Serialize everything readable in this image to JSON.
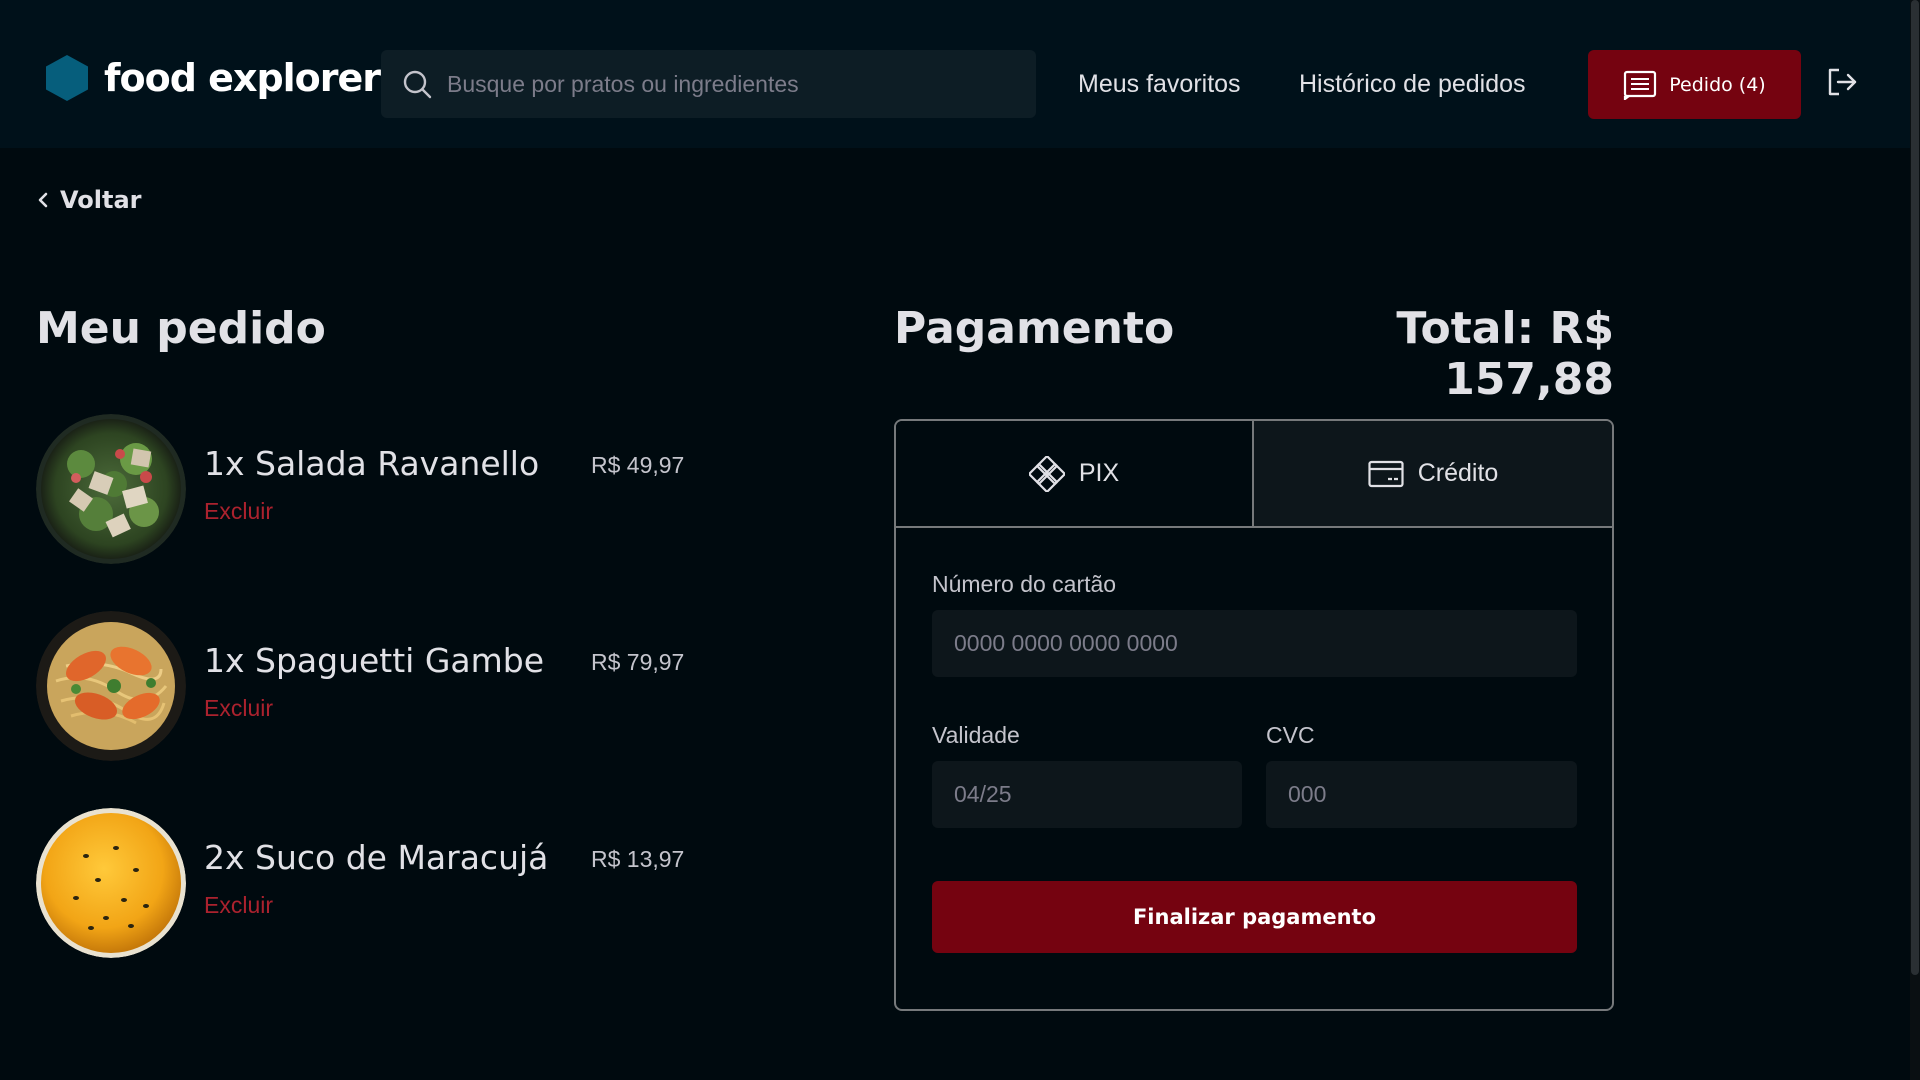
{
  "header": {
    "brand": "food explorer",
    "search_placeholder": "Busque por pratos ou ingredientes",
    "nav_favorites": "Meus favoritos",
    "nav_history": "Histórico de pedidos",
    "order_button_label": "Pedido (4)",
    "icons": {
      "logo": "hexagon-logo-icon",
      "search": "search-icon",
      "order": "receipt-icon",
      "signout": "sign-out-icon"
    }
  },
  "back_label": "Voltar",
  "order": {
    "title": "Meu pedido",
    "delete_label": "Excluir",
    "items": [
      {
        "name": "1x Salada Ravanello",
        "price": "R$ 49,97",
        "image": "salad-dish"
      },
      {
        "name": "1x Spaguetti Gambe",
        "price": "R$ 79,97",
        "image": "shrimp-spaghetti-dish"
      },
      {
        "name": "2x Suco de Maracujá",
        "price": "R$ 13,97",
        "image": "passion-fruit-juice"
      }
    ]
  },
  "payment": {
    "title": "Pagamento",
    "total": "Total: R$ 157,88",
    "tabs": [
      {
        "label": "PIX",
        "icon": "pix-icon",
        "selected": false
      },
      {
        "label": "Crédito",
        "icon": "credit-card-icon",
        "selected": true
      }
    ],
    "card_number_label": "Número do cartão",
    "card_number_placeholder": "0000 0000 0000 0000",
    "expiry_label": "Validade",
    "expiry_placeholder": "04/25",
    "cvc_label": "CVC",
    "cvc_placeholder": "000",
    "submit_label": "Finalizar pagamento"
  },
  "colors": {
    "background": "#000a0f",
    "header": "#00111a",
    "accent_red": "#750310",
    "delete_red": "#ab222e",
    "logo_blue": "#065e7c"
  }
}
